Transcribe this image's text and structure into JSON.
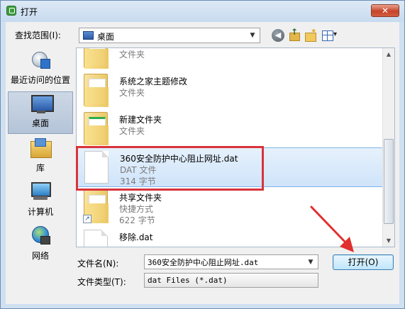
{
  "window": {
    "title": "打开",
    "close_glyph": "✕"
  },
  "toolbar": {
    "lookin_label": "查找范围(I):",
    "lookin_value": "桌面",
    "combo_arrow": "▼",
    "back_glyph": "◀"
  },
  "places": [
    {
      "label": "最近访问的位置",
      "icon": "recent-places-icon"
    },
    {
      "label": "桌面",
      "icon": "desktop-icon",
      "selected": true
    },
    {
      "label": "库",
      "icon": "library-icon"
    },
    {
      "label": "计算机",
      "icon": "computer-icon"
    },
    {
      "label": "网络",
      "icon": "network-icon"
    }
  ],
  "files": [
    {
      "name": "",
      "type": "文件夹",
      "size": "",
      "icon": "folder-icon"
    },
    {
      "name": "系统之家主题修改",
      "type": "文件夹",
      "size": "",
      "icon": "folder-icon"
    },
    {
      "name": "新建文件夹",
      "type": "文件夹",
      "size": "",
      "icon": "folder-icon"
    },
    {
      "name": "360安全防护中心阻止网址.dat",
      "type": "DAT 文件",
      "size": "314 字节",
      "icon": "file-icon",
      "selected": true
    },
    {
      "name": "共享文件夹",
      "type": "快捷方式",
      "size": "622 字节",
      "icon": "shortcut-icon"
    },
    {
      "name": "移除.dat",
      "type": "",
      "size": "",
      "icon": "file-icon"
    }
  ],
  "scroll": {
    "up_glyph": "▲",
    "down_glyph": "▼"
  },
  "form": {
    "filename_label": "文件名(N):",
    "filename_value": "360安全防护中心阻止网址.dat",
    "filetype_label": "文件类型(T):",
    "filetype_value": "dat Files (*.dat)",
    "open_button": "打开(O)"
  },
  "annotation": {
    "highlight_color": "#d9333a"
  }
}
